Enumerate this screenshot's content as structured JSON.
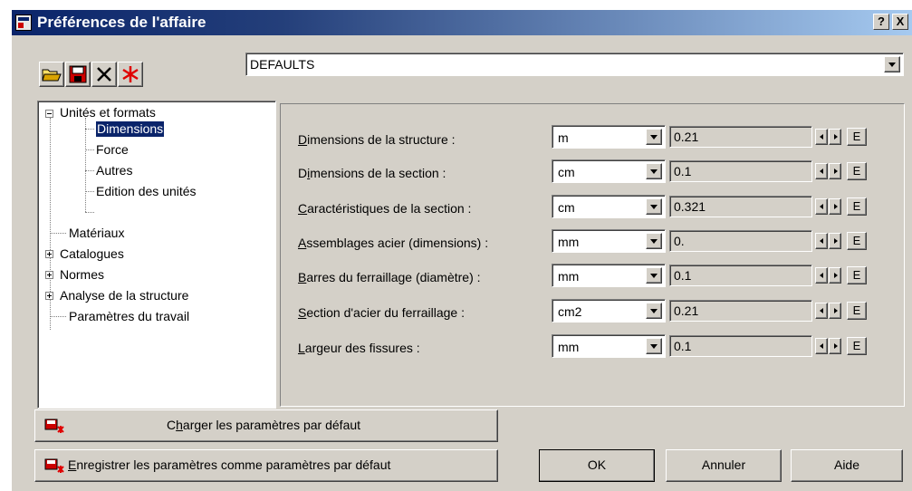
{
  "window": {
    "title": "Préférences de l'affaire",
    "help": "?",
    "close": "X"
  },
  "project_combo": {
    "value": "DEFAULTS"
  },
  "tree": {
    "root": "Unités et formats",
    "children": [
      "Dimensions",
      "Force",
      "Autres",
      "Edition des unités"
    ],
    "items": [
      "Matériaux",
      "Catalogues",
      "Normes",
      "Analyse de la structure",
      "Paramètres du travail"
    ]
  },
  "rows": [
    {
      "label_ul": "D",
      "label_rest": "imensions de la structure :",
      "unit": "m",
      "value": "0.21"
    },
    {
      "label_ul": "i",
      "label_pre": "D",
      "label_rest": "mensions de la section :",
      "unit": "cm",
      "value": "0.1"
    },
    {
      "label_ul": "C",
      "label_rest": "aractéristiques de la section :",
      "unit": "cm",
      "value": "0.321"
    },
    {
      "label_ul": "A",
      "label_rest": "ssemblages acier (dimensions) :",
      "unit": "mm",
      "value": "0."
    },
    {
      "label_ul": "B",
      "label_rest": "arres du ferraillage (diamètre) :",
      "unit": "mm",
      "value": "0.1"
    },
    {
      "label_ul": "S",
      "label_rest": "ection d'acier du ferraillage :",
      "unit": "cm2",
      "value": "0.21"
    },
    {
      "label_ul": "L",
      "label_rest": "argeur des fissures :",
      "unit": "mm",
      "value": "0.1"
    }
  ],
  "e_button": "E",
  "buttons": {
    "load_pre": "C",
    "load_ul": "h",
    "load_rest": "arger les paramètres par défaut",
    "save_ul": "E",
    "save_rest": "nregistrer les paramètres comme paramètres par défaut",
    "ok": "OK",
    "cancel": "Annuler",
    "help": "Aide"
  },
  "icons": [
    "open-folder-icon",
    "save-disk-icon",
    "delete-x-icon",
    "reset-star-icon",
    "load-defaults-icon",
    "save-defaults-icon"
  ],
  "colors": {
    "titlebar": "#0a246a",
    "face": "#d4d0c8",
    "selection": "#0a246a",
    "delete": "#000000",
    "red": "#e00000"
  }
}
